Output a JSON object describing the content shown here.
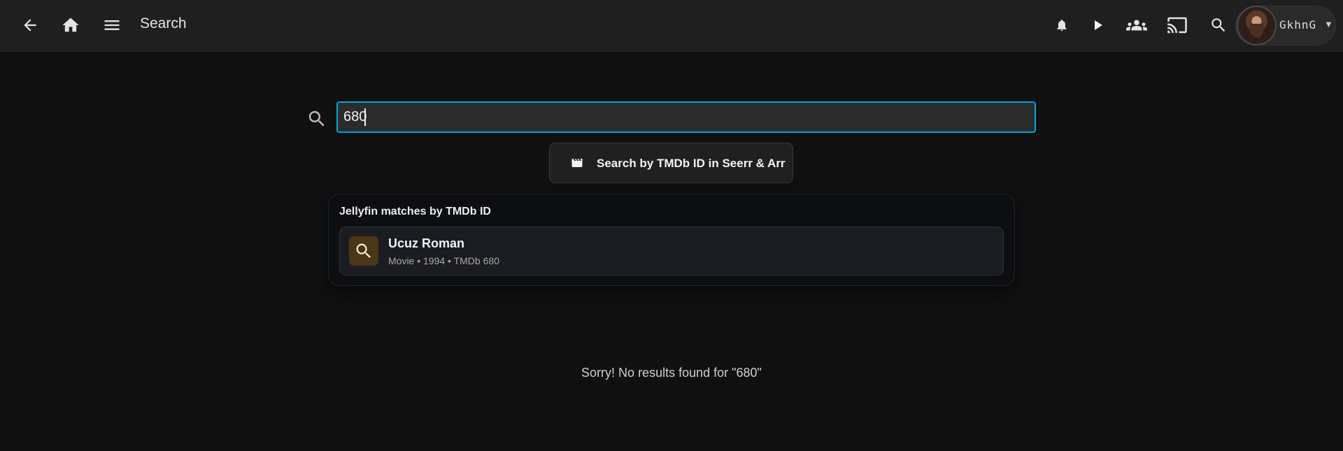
{
  "header": {
    "page_title": "Search",
    "icons": [
      "back-arrow-icon",
      "home-icon",
      "menu-icon",
      "bell-icon",
      "play-icon",
      "group-icon",
      "cast-icon",
      "search-icon"
    ],
    "user": {
      "name": "GkhnG"
    }
  },
  "search": {
    "value": "680"
  },
  "tmdb_button": {
    "label": "Search by TMDb ID in Seerr & Arr"
  },
  "matches": {
    "heading": "Jellyfin matches by TMDb ID",
    "items": [
      {
        "title": "Ucuz Roman",
        "meta": "Movie • 1994 • TMDb 680"
      }
    ]
  },
  "results": {
    "empty_message": "Sorry! No results found for \"680\""
  },
  "colors": {
    "accent": "#00a4dc",
    "topbar": "#1f1f1f",
    "background": "#101010"
  }
}
